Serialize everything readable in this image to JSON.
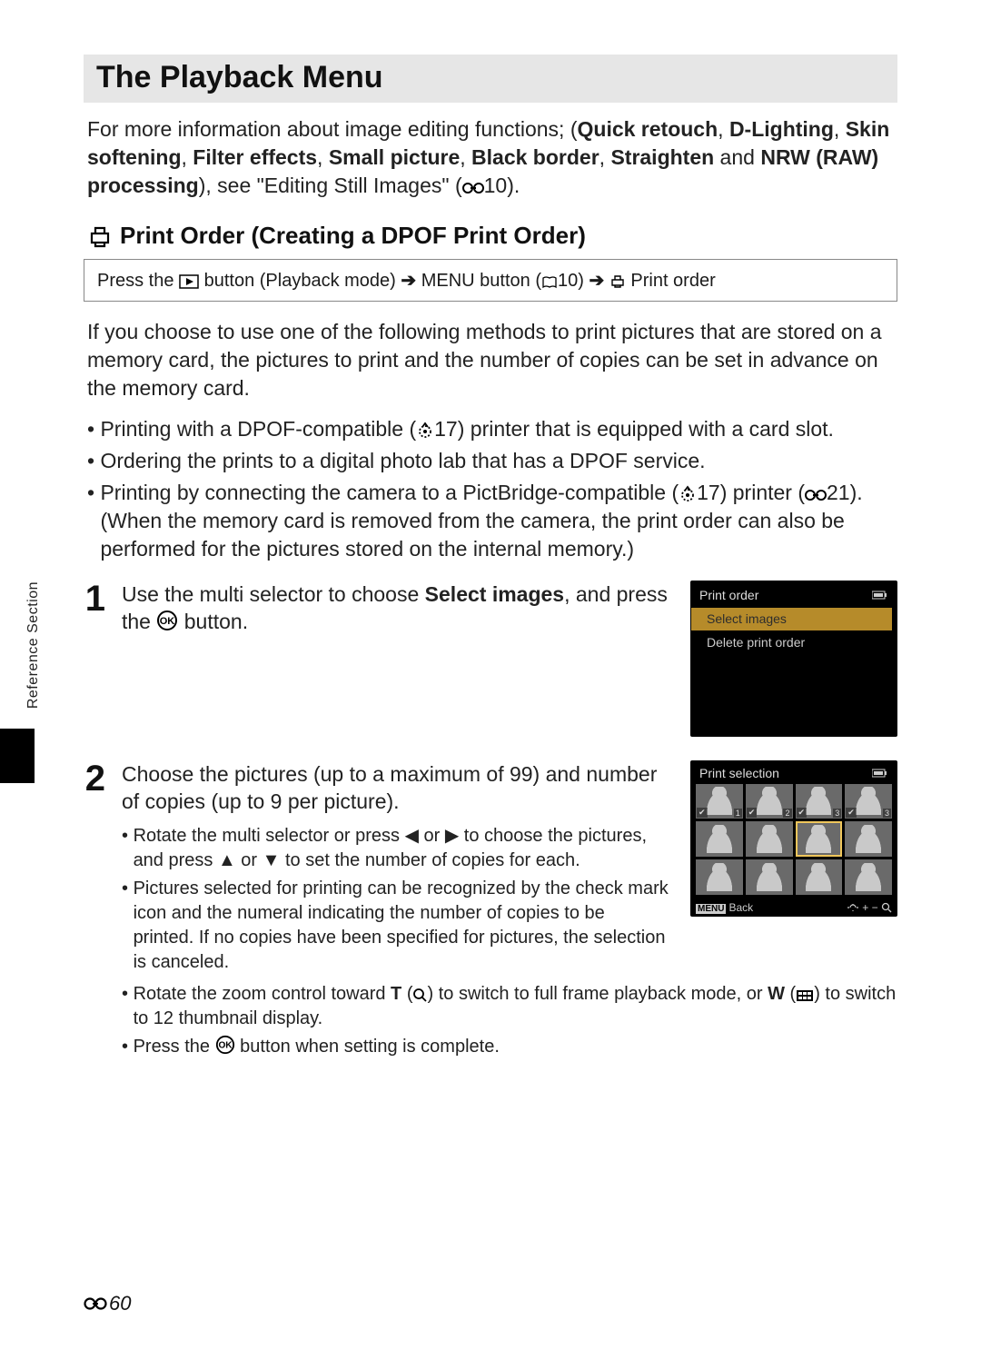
{
  "title": "The Playback Menu",
  "intro": {
    "lead": "For more information about image editing functions; (",
    "features": [
      "Quick retouch",
      "D-Lighting",
      "Skin softening",
      "Filter effects",
      "Small picture",
      "Black border",
      "Straighten",
      "NRW (RAW) processing"
    ],
    "and": " and ",
    "tail": "), see \"Editing Still Images\" (",
    "tail_ref": "10",
    "tail_end": ")."
  },
  "subheading": "Print Order (Creating a DPOF Print Order)",
  "nav": {
    "a": "Press the",
    "b": "button (Playback mode)",
    "c": "MENU button (",
    "c_ref": "10",
    "c_end": ")",
    "d": "Print order"
  },
  "para1": "If you choose to use one of the following methods to print pictures that are stored on a memory card, the pictures to print and the number of copies can be set in advance on the memory card.",
  "bullets": [
    {
      "pre": "Printing with a DPOF-compatible (",
      "ref": "17",
      "post": ") printer that is equipped with a card slot."
    },
    {
      "text": "Ordering the prints to a digital photo lab that has a DPOF service."
    },
    {
      "pre": "Printing by connecting the camera to a PictBridge-compatible (",
      "ref": "17",
      "mid": ") printer (",
      "ref2": "21",
      "post": "). (When the memory card is removed from the camera, the print order can also be performed for the pictures stored on the internal memory.)"
    }
  ],
  "step1": {
    "num": "1",
    "text_a": "Use the multi selector to choose ",
    "bold": "Select images",
    "text_b": ", and press the ",
    "text_c": " button.",
    "lcd_title": "Print order",
    "lcd_items": [
      "Select images",
      "Delete print order"
    ]
  },
  "step2": {
    "num": "2",
    "head": "Choose the pictures (up to a maximum of 99) and number of copies (up to 9 per picture).",
    "subs": [
      "Rotate the multi selector or press ◀ or ▶ to choose the pictures, and press ▲ or ▼ to set the number of copies for each.",
      "Pictures selected for printing can be recognized by the check mark icon and the numeral indicating the number of copies to be printed. If no copies have been specified for pictures, the selection is canceled.",
      "Rotate the zoom control toward T (🔍) to switch to full frame playback mode, or W (⊞) to switch to 12 thumbnail display.",
      "Press the ⓀⓀ button when setting is complete."
    ],
    "sub3_a": "Rotate the zoom control toward ",
    "sub3_T": "T",
    "sub3_b": " (",
    "sub3_c": ") to switch to full frame playback mode, or ",
    "sub3_W": "W",
    "sub3_d": " (",
    "sub3_e": ") to switch to 12 thumbnail display.",
    "sub4_a": "Press the ",
    "sub4_b": " button when setting is complete.",
    "lcd_title": "Print selection",
    "lcd_back": "Back",
    "lcd_pm": "+ −",
    "thumbs": [
      {
        "check": true,
        "n": "1"
      },
      {
        "check": true,
        "n": "2"
      },
      {
        "check": true,
        "n": "3"
      },
      {
        "check": true,
        "n": "3"
      },
      {},
      {},
      {
        "sel": true
      },
      {},
      {},
      {},
      {},
      {}
    ]
  },
  "spine": "Reference Section",
  "page_num": "60"
}
